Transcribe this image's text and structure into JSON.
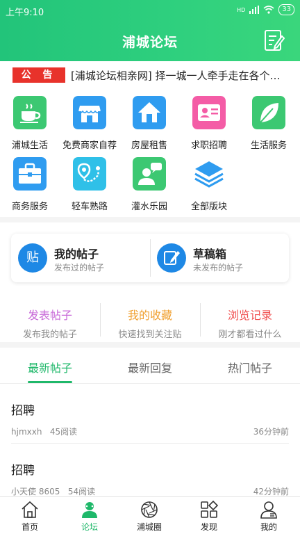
{
  "status": {
    "time": "上午9:10",
    "network": "HD",
    "battery": "33"
  },
  "header": {
    "title": "浦城论坛"
  },
  "notice": {
    "badge": "公 告",
    "text": "[浦城论坛相亲网] 择一城一人牵手走在各个…"
  },
  "grid": {
    "items": [
      {
        "label": "浦城生活",
        "icon": "coffee-cup-icon",
        "color": "#3cc872"
      },
      {
        "label": "免费商家自荐",
        "icon": "shop-icon",
        "color": "#2f9cf0"
      },
      {
        "label": "房屋租售",
        "icon": "house-icon",
        "color": "#2f9cf0"
      },
      {
        "label": "求职招聘",
        "icon": "id-card-icon",
        "color": "#f45ca6"
      },
      {
        "label": "生活服务",
        "icon": "leaf-icon",
        "color": "#3cc872"
      },
      {
        "label": "商务服务",
        "icon": "briefcase-icon",
        "color": "#2f9cf0"
      },
      {
        "label": "轻车熟路",
        "icon": "route-icon",
        "color": "#2fc0e8"
      },
      {
        "label": "灌水乐园",
        "icon": "chat-person-icon",
        "color": "#3cc872"
      },
      {
        "label": "全部版块",
        "icon": "layers-icon",
        "color": "#2f9cf0"
      }
    ]
  },
  "my": {
    "posts": {
      "title": "我的帖子",
      "sub": "发布过的帖子",
      "icon_text": "贴"
    },
    "drafts": {
      "title": "草稿箱",
      "sub": "未发布的帖子"
    }
  },
  "actions": [
    {
      "title": "发表帖子",
      "sub": "发布我的帖子",
      "color": "#c86ad8"
    },
    {
      "title": "我的收藏",
      "sub": "快速找到关注贴",
      "color": "#f0a030"
    },
    {
      "title": "浏览记录",
      "sub": "刚才都看过什么",
      "color": "#f05050"
    }
  ],
  "tabs": [
    "最新帖子",
    "最新回复",
    "热门帖子"
  ],
  "posts": [
    {
      "title": "招聘",
      "author": "hjmxxh",
      "reads": "45阅读",
      "time": "36分钟前"
    },
    {
      "title": "招聘",
      "author": "小天使 8605",
      "reads": "54阅读",
      "time": "42分钟前"
    }
  ],
  "bottom_nav": [
    "首页",
    "论坛",
    "浦城圈",
    "发现",
    "我的"
  ],
  "colors": {
    "accent": "#1fb86a",
    "header": "#2fd07e",
    "notice_badge": "#e8322b"
  }
}
